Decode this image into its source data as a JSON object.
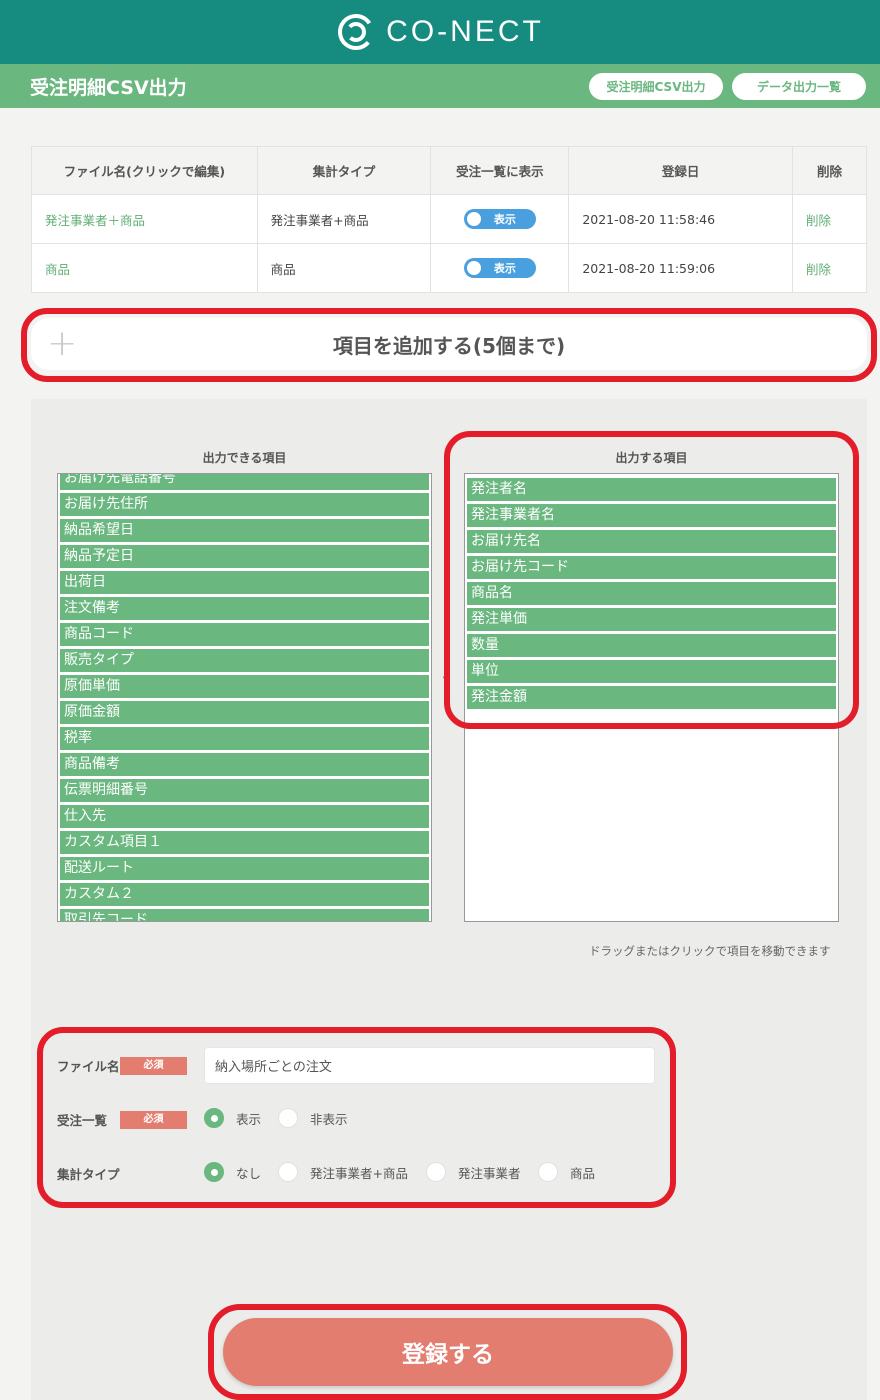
{
  "header": {
    "logo_text": "CO-NECT"
  },
  "subheader": {
    "title": "受注明細CSV出力",
    "buttons": [
      "受注明細CSV出力",
      "データ出力一覧"
    ]
  },
  "table": {
    "headers": [
      "ファイル名(クリックで編集)",
      "集計タイプ",
      "受注一覧に表示",
      "登録日",
      "削除"
    ],
    "rows": [
      {
        "name": "発注事業者＋商品",
        "type": "発注事業者+商品",
        "toggle": "表示",
        "date": "2021-08-20 11:58:46",
        "delete": "削除"
      },
      {
        "name": "商品",
        "type": "商品",
        "toggle": "表示",
        "date": "2021-08-20 11:59:06",
        "delete": "削除"
      }
    ]
  },
  "add_item": {
    "label": "項目を追加する(5個まで)"
  },
  "left_list": {
    "title": "出力できる項目",
    "items": [
      "お届け先電話番号",
      "お届け先住所",
      "納品希望日",
      "納品予定日",
      "出荷日",
      "注文備考",
      "商品コード",
      "販売タイプ",
      "原価単価",
      "原価金額",
      "税率",
      "商品備考",
      "伝票明細番号",
      "仕入先",
      "カスタム項目１",
      "配送ルート",
      "カスタム２",
      "取引先コード"
    ]
  },
  "right_list": {
    "title": "出力する項目",
    "items": [
      "発注者名",
      "発注事業者名",
      "お届け先名",
      "お届け先コード",
      "商品名",
      "発注単価",
      "数量",
      "単位",
      "発注金額"
    ]
  },
  "arrow": "‹",
  "drag_hint": "ドラッグまたはクリックで項目を移動できます",
  "form": {
    "file_name_label": "ファイル名",
    "required": "必須",
    "file_name_value": "納入場所ごとの注文",
    "list_label": "受注一覧",
    "list_options": [
      "表示",
      "非表示"
    ],
    "list_selected": 0,
    "agg_label": "集計タイプ",
    "agg_options": [
      "なし",
      "発注事業者+商品",
      "発注事業者",
      "商品"
    ],
    "agg_selected": 0
  },
  "submit": {
    "label": "登録する"
  },
  "colors": {
    "teal": "#168c80",
    "green": "#6ab77f",
    "salmon": "#e37d70",
    "red": "#e31e2a",
    "blue": "#4a9fde"
  }
}
